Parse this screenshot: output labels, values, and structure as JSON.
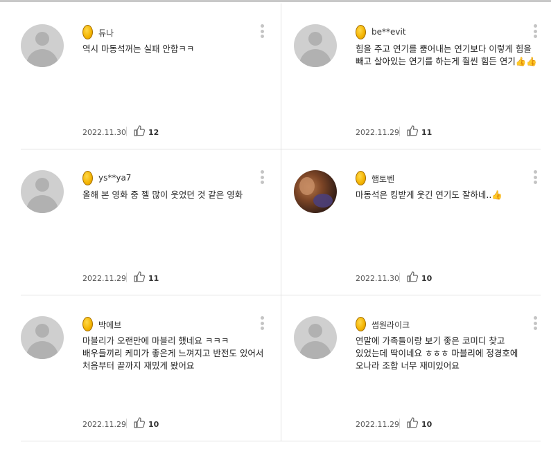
{
  "reviews": [
    {
      "nickname": "듀나",
      "text": "역시 마동석꺼는 실패 안함ㅋㅋ",
      "date": "2022.11.30",
      "likes": "12",
      "avatar": "default"
    },
    {
      "nickname": "be**evit",
      "text": "힘을 주고 연기를 뿜어내는 연기보다 이렇게 힘을 빼고 살아있는 연기를 하는게 훨씬 힘든 연기👍👍",
      "date": "2022.11.29",
      "likes": "11",
      "avatar": "default"
    },
    {
      "nickname": "ys**ya7",
      "text": "올해 본 영화 중 젤 많이 웃었던 것 같은 영화",
      "date": "2022.11.29",
      "likes": "11",
      "avatar": "default"
    },
    {
      "nickname": "햄토벤",
      "text": "마동석은 킹받게 웃긴 연기도 잘하네..👍",
      "date": "2022.11.30",
      "likes": "10",
      "avatar": "photo"
    },
    {
      "nickname": "박에브",
      "text": "마블리가 오랜만에 마블리 했네요 ㅋㅋㅋ 배우들끼리 케미가 좋은게 느껴지고 반전도 있어서 처음부터 끝까지 재밌게 봤어요",
      "date": "2022.11.29",
      "likes": "10",
      "avatar": "default"
    },
    {
      "nickname": "썸원라이크",
      "text": "연말에 가족들이랑 보기 좋은 코미디 찾고 있었는데 딱이네요 ㅎㅎㅎ 마블리에 정경호에 오나라 조합 너무 재미있어요",
      "date": "2022.11.29",
      "likes": "10",
      "avatar": "default"
    }
  ],
  "icons": {
    "badge": "gold-egg-badge-icon",
    "like": "thumbs-up-icon",
    "more": "more-vertical-icon",
    "avatar": "user-avatar-icon"
  },
  "colors": {
    "badge": "#f3b300",
    "divider": "#e2e2e2",
    "avatar": "#cfcfcf"
  }
}
